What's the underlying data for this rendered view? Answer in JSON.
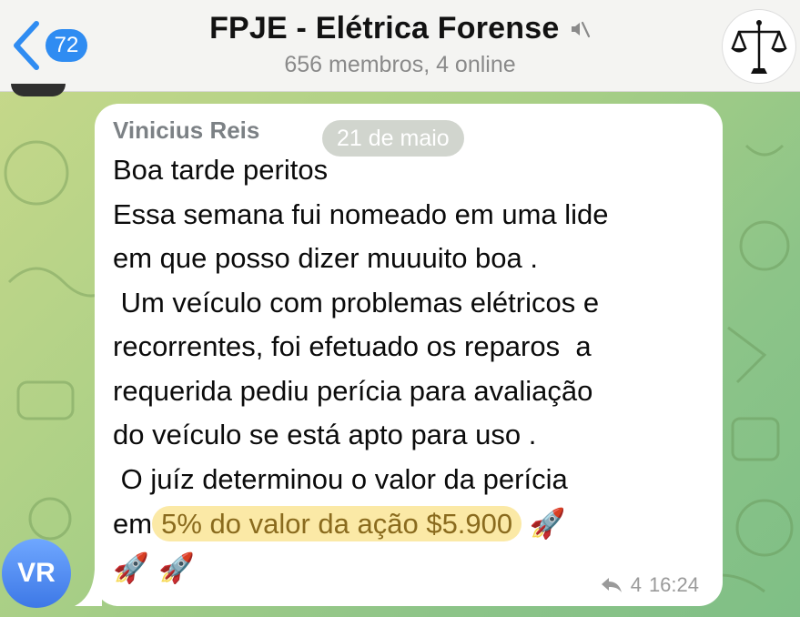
{
  "header": {
    "unread_count": "72",
    "title": "FPJE - Elétrica Forense",
    "subtitle": "656 membros, 4 online"
  },
  "message": {
    "sender": "Vinicius Reis",
    "date": "21 de maio",
    "lines": [
      "Boa tarde peritos",
      "Essa semana fui nomeado em uma lide",
      "em que posso dizer muuuito boa .",
      " Um veículo com problemas elétricos e",
      "recorrentes, foi efetuado os reparos  a",
      "requerida pediu perícia para avaliação",
      "do veículo se está apto para uso .",
      " O juíz determinou o valor da perícia"
    ],
    "last_line_prefix": "em",
    "highlight": "5% do valor da ação $5.900",
    "emoji_after_highlight": "🚀",
    "emoji_line": "🚀 🚀",
    "reply_count": "4",
    "time": "16:24"
  },
  "sender_avatar": {
    "initials": "VR",
    "color": "#4a86ee"
  },
  "colors": {
    "accent": "#2f8cf2",
    "highlight_bg": "#fbe9a6"
  },
  "icons": {
    "back": "chevron-left-icon",
    "mute": "muted-speaker-icon",
    "group_avatar": "scales-of-justice-icon",
    "reply": "reply-arrow-icon"
  }
}
